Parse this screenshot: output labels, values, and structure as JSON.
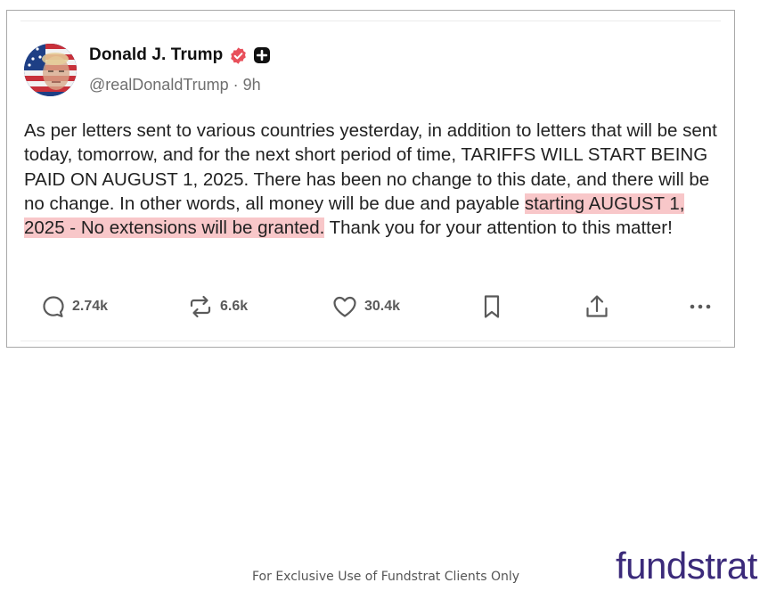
{
  "post": {
    "author": {
      "display_name": "Donald J. Trump",
      "handle": "@realDonaldTrump",
      "separator": " · ",
      "time": "9h",
      "verified_icon": "verified-badge-icon",
      "plus_icon": "plus-badge-icon"
    },
    "body": {
      "text_before_highlight": "As per letters sent to various countries yesterday, in addition to letters that will be sent today, tomorrow, and for the next short period of time, TARIFFS WILL START BEING PAID ON AUGUST 1, 2025. There has been no change to this date, and there will be no change. In other words, all money will be due and payable ",
      "highlighted_text": "starting AUGUST 1, 2025 - No extensions will be granted.",
      "text_after_highlight": " Thank you for your attention to this matter!"
    },
    "actions": {
      "reply_count": "2.74k",
      "repost_count": "6.6k",
      "like_count": "30.4k"
    }
  },
  "footer": {
    "note": "For Exclusive Use of Fundstrat Clients Only",
    "brand": "fundstrat"
  },
  "colors": {
    "highlight": "#f8c7c9",
    "verified_badge": "#e8505b",
    "brand": "#3b2a7a",
    "action_icon": "#5a5a5a"
  }
}
